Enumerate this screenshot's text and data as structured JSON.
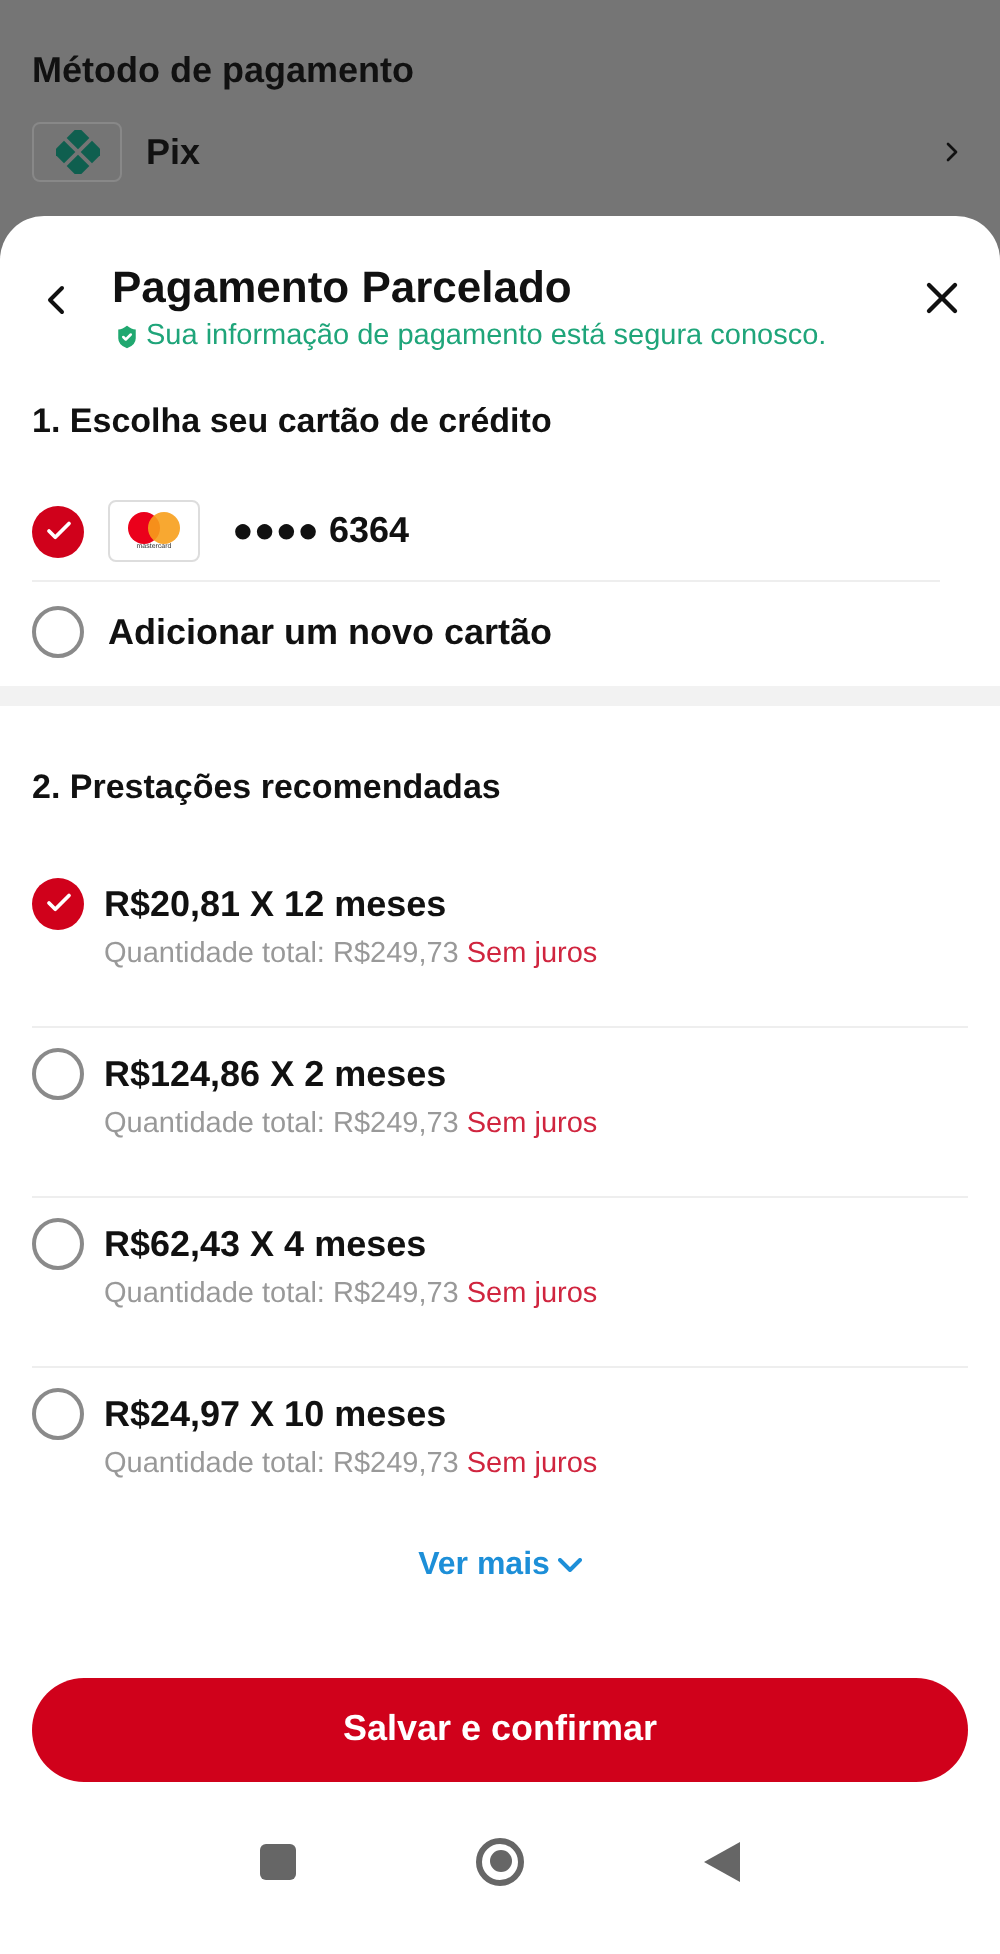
{
  "background": {
    "title": "Método de pagamento",
    "method": "Pix"
  },
  "sheet": {
    "title": "Pagamento Parcelado",
    "security_note": "Sua informação de pagamento está segura conosco.",
    "cards_heading": "1. Escolha seu cartão de crédito",
    "cards": [
      {
        "kind": "card",
        "brand_label": "mastercard",
        "number": "●●●● 6364",
        "selected": true
      },
      {
        "kind": "add",
        "label": "Adicionar um novo cartão",
        "selected": false
      }
    ],
    "installments_heading": "2. Prestações recomendadas",
    "installments": [
      {
        "title": "R$20,81 X 12 meses",
        "total": "Quantidade total: R$249,73",
        "tag": "Sem juros",
        "selected": true
      },
      {
        "title": "R$124,86 X 2 meses",
        "total": "Quantidade total: R$249,73",
        "tag": "Sem juros",
        "selected": false
      },
      {
        "title": "R$62,43 X 4 meses",
        "total": "Quantidade total: R$249,73",
        "tag": "Sem juros",
        "selected": false
      },
      {
        "title": "R$24,97 X 10 meses",
        "total": "Quantidade total: R$249,73",
        "tag": "Sem juros",
        "selected": false
      }
    ],
    "more": "Ver mais",
    "confirm": "Salvar e confirmar"
  }
}
